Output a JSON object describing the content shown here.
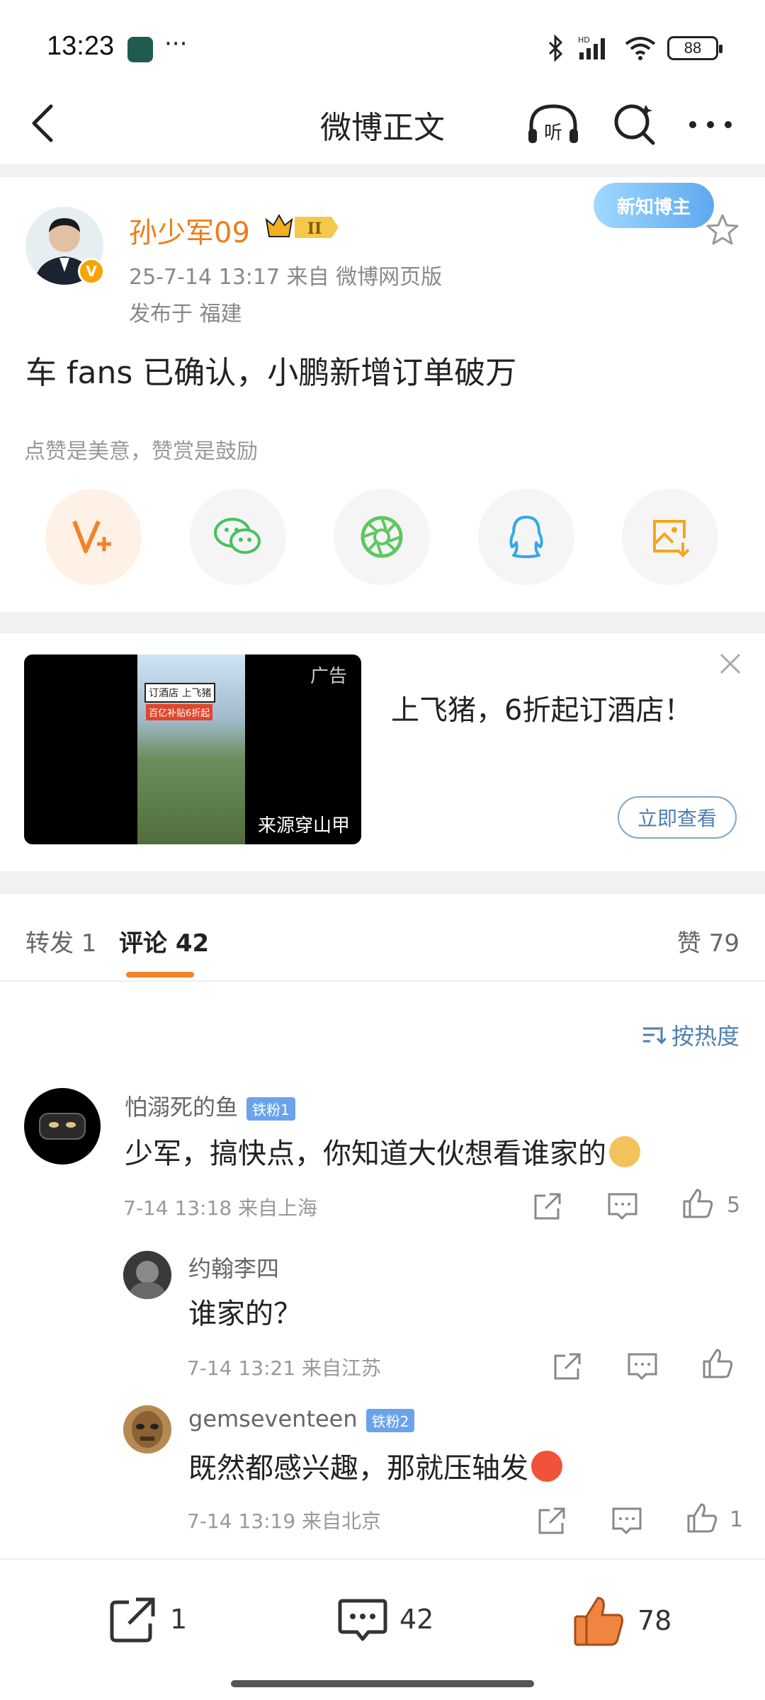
{
  "status_bar": {
    "time": "13:23",
    "dots": "···",
    "battery": "88",
    "network_label": "HD"
  },
  "nav": {
    "title": "微博正文",
    "listen_label": "听"
  },
  "post": {
    "username": "孙少军09",
    "crown_level": "II",
    "badge_text": "新知博主",
    "date_source": "25-7-14 13:17   来自 微博网页版",
    "location": "发布于 福建",
    "text": "车 fans 已确认，小鹏新增订单破万",
    "like_tip": "点赞是美意，赞赏是鼓励",
    "share_icons": [
      "vplus-icon",
      "wechat-icon",
      "moments-icon",
      "qq-icon",
      "save-image-icon"
    ]
  },
  "ad": {
    "tag": "广告",
    "source": "来源穿山甲",
    "text": "上飞猪，6折起订酒店！",
    "button": "立即查看",
    "image_lines": [
      "订酒店 上飞猪",
      "百亿补贴6折起"
    ]
  },
  "tabs": {
    "repost": "转发 1",
    "comments": "评论 42",
    "likes": "赞 79"
  },
  "sort_label": "按热度",
  "comments": [
    {
      "name": "怕溺死的鱼",
      "fan_badge": "铁粉1",
      "text": "少军，搞快点，你知道大伙想看谁家的",
      "meta": "7-14 13:18  来自上海",
      "likes": "5"
    },
    {
      "name": "约翰李四",
      "text": "谁家的？",
      "meta": "7-14 13:21  来自江苏",
      "likes": ""
    },
    {
      "name": "gemseventeen",
      "fan_badge": "铁粉2",
      "text": "既然都感兴趣，那就压轴发",
      "meta": "7-14 13:19  来自北京",
      "likes": "1"
    }
  ],
  "bottom_bar": {
    "reposts": "1",
    "comments": "42",
    "likes": "78"
  },
  "colors": {
    "accent_orange": "#ee7d18",
    "link_blue": "#4e7fb0",
    "tab_underline": "#f2822b"
  }
}
